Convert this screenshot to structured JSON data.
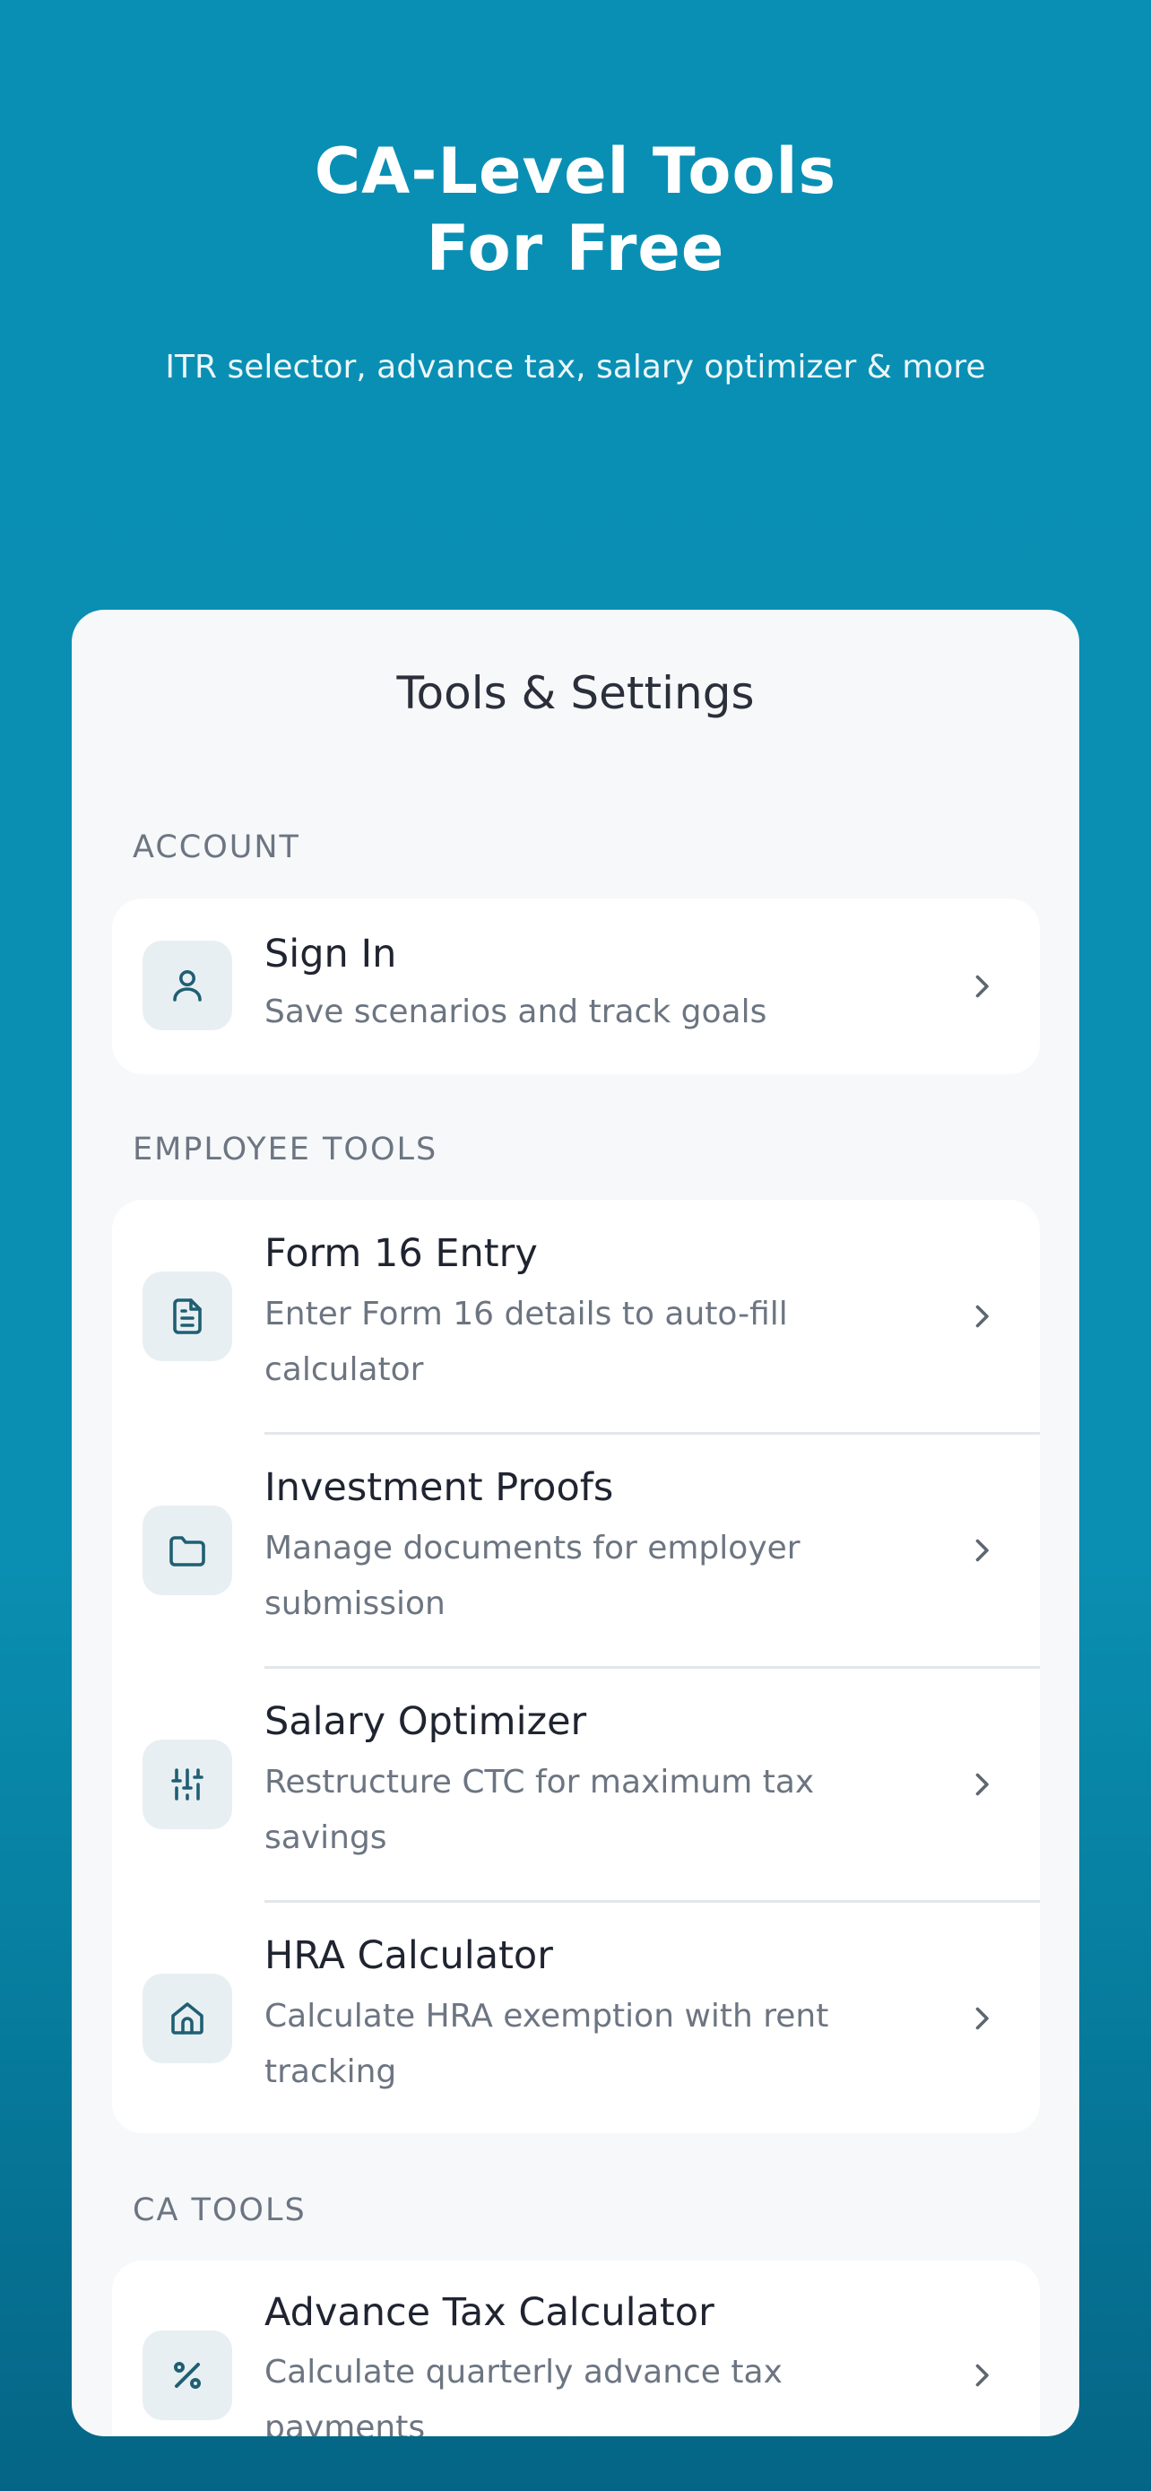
{
  "hero": {
    "title_line1": "CA-Level Tools",
    "title_line2": "For Free",
    "subtitle": "ITR selector, advance tax, salary optimizer & more"
  },
  "sheet": {
    "title": "Tools & Settings",
    "sections": {
      "account": {
        "label": "ACCOUNT",
        "items": [
          {
            "icon": "user-icon",
            "title": "Sign In",
            "desc": "Save scenarios and track goals"
          }
        ]
      },
      "employee_tools": {
        "label": "EMPLOYEE TOOLS",
        "items": [
          {
            "icon": "document-icon",
            "title": "Form 16 Entry",
            "desc": "Enter Form 16 details to auto-fill calculator"
          },
          {
            "icon": "folder-icon",
            "title": "Investment Proofs",
            "desc": "Manage documents for employer submission"
          },
          {
            "icon": "sliders-icon",
            "title": "Salary Optimizer",
            "desc": "Restructure CTC for maximum tax savings"
          },
          {
            "icon": "home-icon",
            "title": "HRA Calculator",
            "desc": "Calculate HRA exemption with rent tracking"
          }
        ]
      },
      "ca_tools": {
        "label": "CA TOOLS",
        "items": [
          {
            "icon": "percent-icon",
            "title": "Advance Tax Calculator",
            "desc": "Calculate quarterly advance tax payments"
          }
        ]
      }
    }
  },
  "colors": {
    "background": "#0a8fb4",
    "icon_stroke": "#1f5f73",
    "sheet": "#f6f8fa"
  }
}
